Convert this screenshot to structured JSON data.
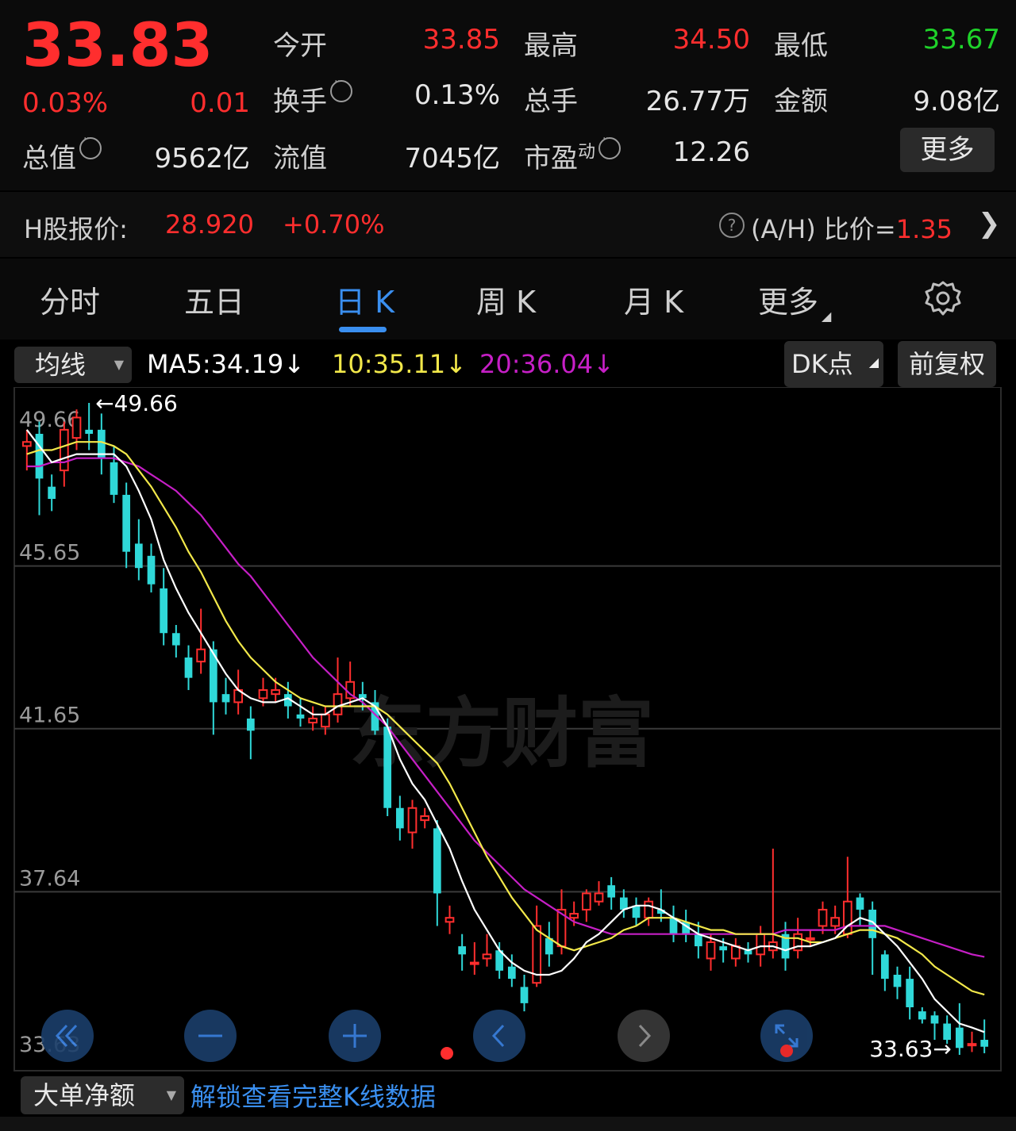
{
  "quote": {
    "price": "33.83",
    "change_pct": "0.03%",
    "change": "0.01",
    "open_label": "今开",
    "open": "33.85",
    "high_label": "最高",
    "high": "34.50",
    "low_label": "最低",
    "low": "33.67",
    "turnover_label": "换手",
    "turnover": "0.13%",
    "volume_label": "总手",
    "volume": "26.77万",
    "amount_label": "金额",
    "amount": "9.08亿",
    "mktcap_label": "总值",
    "mktcap": "9562亿",
    "float_label": "流值",
    "float": "7045亿",
    "pe_label": "市盈",
    "pe_sup": "动",
    "pe": "12.26",
    "more_label": "更多"
  },
  "hshare": {
    "label": "H股报价:",
    "price": "28.920",
    "change": "+0.70%",
    "ratio_label": "(A/H) 比价=",
    "ratio": "1.35"
  },
  "tabs": [
    {
      "label": "分时"
    },
    {
      "label": "五日"
    },
    {
      "label": "日 K"
    },
    {
      "label": "周 K"
    },
    {
      "label": "月 K"
    },
    {
      "label": "更多"
    }
  ],
  "chart_controls": {
    "indicator": "均线",
    "ma5": "MA5:34.19↓",
    "ma10": "10:35.11↓",
    "ma20": "20:36.04↓",
    "dk_label": "DK点",
    "adjust_label": "前复权"
  },
  "bottom": {
    "indicator": "大单净额",
    "unlock": "解锁查看完整K线数据"
  },
  "watermark": "东方财富",
  "colors": {
    "up": "#ff2e2e",
    "down": "#2fd8d8",
    "ma5": "#ffffff",
    "ma10": "#f2e84a",
    "ma20": "#c61fc6",
    "accent": "#3a8ff0"
  },
  "chart_data": {
    "type": "candlestick",
    "ylim": [
      33.63,
      49.66
    ],
    "y_ticks": [
      "49.66",
      "45.65",
      "41.65",
      "37.64",
      "33.63"
    ],
    "max_label": "←49.66",
    "min_label": "33.63→",
    "candles": [
      [
        48.6,
        48.7,
        49.0,
        48.0
      ],
      [
        48.9,
        47.8,
        49.2,
        46.9
      ],
      [
        47.6,
        47.3,
        47.9,
        47.0
      ],
      [
        48.0,
        49.0,
        49.2,
        47.6
      ],
      [
        48.8,
        49.3,
        49.5,
        48.5
      ],
      [
        49.0,
        48.9,
        49.66,
        48.5
      ],
      [
        49.0,
        48.3,
        49.4,
        47.9
      ],
      [
        48.2,
        47.4,
        48.6,
        47.2
      ],
      [
        47.4,
        46.0,
        47.7,
        45.6
      ],
      [
        46.2,
        45.6,
        46.8,
        45.3
      ],
      [
        45.9,
        45.2,
        46.2,
        45.0
      ],
      [
        45.1,
        44.0,
        45.6,
        43.7
      ],
      [
        44.0,
        43.7,
        44.2,
        43.4
      ],
      [
        43.4,
        42.9,
        43.7,
        42.6
      ],
      [
        43.3,
        43.6,
        44.6,
        43.0
      ],
      [
        43.6,
        42.3,
        43.8,
        41.5
      ],
      [
        42.5,
        42.3,
        42.9,
        42.0
      ],
      [
        42.3,
        42.6,
        43.1,
        42.0
      ],
      [
        41.9,
        41.6,
        42.2,
        40.9
      ],
      [
        42.4,
        42.6,
        42.9,
        42.2
      ],
      [
        42.5,
        42.6,
        42.9,
        42.3
      ],
      [
        42.5,
        42.2,
        42.8,
        41.9
      ],
      [
        42.0,
        41.9,
        42.4,
        41.7
      ],
      [
        41.8,
        41.9,
        42.2,
        41.6
      ],
      [
        41.7,
        42.0,
        42.2,
        41.5
      ],
      [
        42.0,
        42.5,
        43.4,
        41.8
      ],
      [
        42.4,
        42.8,
        43.3,
        42.2
      ],
      [
        42.5,
        42.4,
        42.8,
        42.1
      ],
      [
        42.3,
        41.6,
        42.6,
        41.5
      ],
      [
        41.7,
        39.7,
        41.9,
        39.5
      ],
      [
        39.7,
        39.2,
        40.0,
        38.9
      ],
      [
        39.1,
        39.7,
        39.9,
        38.7
      ],
      [
        39.4,
        39.5,
        39.7,
        39.2
      ],
      [
        39.2,
        37.6,
        39.4,
        36.8
      ],
      [
        36.9,
        37.0,
        37.3,
        36.6
      ],
      [
        36.3,
        36.1,
        36.6,
        35.7
      ],
      [
        35.9,
        35.9,
        36.4,
        35.6
      ],
      [
        36.0,
        36.1,
        36.6,
        35.8
      ],
      [
        36.2,
        35.7,
        36.4,
        35.5
      ],
      [
        35.8,
        35.5,
        36.1,
        35.3
      ],
      [
        35.3,
        34.9,
        35.6,
        34.7
      ],
      [
        35.4,
        36.8,
        37.3,
        35.3
      ],
      [
        36.5,
        36.1,
        36.9,
        35.8
      ],
      [
        36.3,
        37.2,
        37.7,
        36.1
      ],
      [
        37.0,
        37.1,
        37.4,
        36.8
      ],
      [
        37.2,
        37.6,
        37.7,
        36.9
      ],
      [
        37.4,
        37.6,
        37.9,
        37.3
      ],
      [
        37.8,
        37.5,
        38.0,
        37.2
      ],
      [
        37.5,
        37.2,
        37.7,
        37.0
      ],
      [
        37.3,
        37.0,
        37.5,
        36.8
      ],
      [
        37.0,
        37.4,
        37.5,
        36.8
      ],
      [
        37.2,
        37.1,
        37.7,
        36.9
      ],
      [
        37.0,
        36.6,
        37.3,
        36.4
      ],
      [
        36.9,
        36.6,
        37.2,
        36.4
      ],
      [
        36.6,
        36.3,
        36.9,
        36.0
      ],
      [
        36.0,
        36.4,
        36.6,
        35.7
      ],
      [
        36.3,
        36.2,
        36.5,
        35.9
      ],
      [
        36.0,
        36.3,
        36.5,
        35.8
      ],
      [
        36.2,
        36.1,
        36.4,
        35.9
      ],
      [
        36.1,
        36.6,
        36.8,
        35.8
      ],
      [
        36.2,
        36.4,
        38.7,
        36.0
      ],
      [
        36.6,
        36.0,
        36.9,
        35.7
      ],
      [
        36.2,
        36.6,
        37.0,
        36.0
      ],
      [
        36.5,
        36.5,
        36.7,
        36.3
      ],
      [
        36.8,
        37.2,
        37.4,
        36.6
      ],
      [
        36.8,
        37.0,
        37.3,
        36.6
      ],
      [
        36.6,
        37.4,
        38.5,
        36.5
      ],
      [
        37.5,
        37.2,
        37.6,
        36.8
      ],
      [
        37.2,
        36.5,
        37.4,
        35.6
      ],
      [
        36.1,
        35.5,
        36.2,
        35.2
      ],
      [
        35.6,
        35.3,
        35.8,
        35.0
      ],
      [
        35.5,
        34.8,
        35.8,
        34.5
      ],
      [
        34.7,
        34.5,
        34.8,
        34.4
      ],
      [
        34.6,
        34.4,
        34.7,
        34.0
      ],
      [
        34.4,
        34.0,
        34.6,
        33.9
      ],
      [
        34.3,
        33.8,
        34.9,
        33.63
      ],
      [
        33.9,
        33.9,
        34.2,
        33.7
      ],
      [
        34.0,
        33.83,
        34.5,
        33.67
      ]
    ],
    "ma5": [
      49.0,
      48.6,
      48.2,
      48.3,
      48.4,
      48.4,
      48.4,
      48.4,
      48.1,
      47.5,
      46.8,
      45.8,
      45.1,
      44.5,
      44.0,
      43.5,
      43.0,
      42.6,
      42.4,
      42.3,
      42.3,
      42.4,
      42.2,
      42.0,
      42.0,
      42.2,
      42.3,
      42.4,
      42.2,
      41.7,
      40.9,
      40.3,
      39.9,
      39.3,
      38.7,
      37.9,
      37.2,
      36.7,
      36.2,
      35.9,
      35.7,
      35.6,
      35.6,
      35.7,
      36.0,
      36.4,
      36.6,
      36.9,
      37.2,
      37.3,
      37.3,
      37.2,
      37.0,
      36.8,
      36.6,
      36.5,
      36.4,
      36.3,
      36.2,
      36.3,
      36.3,
      36.2,
      36.3,
      36.3,
      36.4,
      36.5,
      36.8,
      37.0,
      36.9,
      36.6,
      36.3,
      35.9,
      35.5,
      35.0,
      34.7,
      34.4,
      34.3,
      34.19
    ],
    "ma10": [
      48.4,
      48.5,
      48.5,
      48.6,
      48.7,
      48.7,
      48.7,
      48.6,
      48.4,
      48.0,
      47.6,
      47.1,
      46.6,
      46.0,
      45.5,
      44.9,
      44.3,
      43.8,
      43.4,
      43.1,
      42.8,
      42.6,
      42.4,
      42.3,
      42.2,
      42.2,
      42.2,
      42.2,
      42.2,
      42.0,
      41.7,
      41.4,
      41.1,
      40.8,
      40.3,
      39.7,
      39.1,
      38.5,
      38.0,
      37.5,
      37.1,
      36.7,
      36.5,
      36.3,
      36.2,
      36.3,
      36.4,
      36.5,
      36.7,
      36.8,
      37.0,
      37.0,
      37.0,
      36.9,
      36.8,
      36.7,
      36.7,
      36.6,
      36.6,
      36.6,
      36.6,
      36.5,
      36.5,
      36.4,
      36.4,
      36.5,
      36.6,
      36.7,
      36.7,
      36.6,
      36.5,
      36.3,
      36.1,
      35.8,
      35.6,
      35.4,
      35.2,
      35.11
    ],
    "ma20": [
      48.1,
      48.1,
      48.2,
      48.2,
      48.3,
      48.3,
      48.3,
      48.3,
      48.2,
      48.1,
      47.9,
      47.7,
      47.5,
      47.2,
      46.9,
      46.5,
      46.1,
      45.7,
      45.4,
      45.0,
      44.6,
      44.2,
      43.8,
      43.4,
      43.1,
      42.8,
      42.5,
      42.3,
      42.0,
      41.7,
      41.3,
      40.9,
      40.5,
      40.1,
      39.7,
      39.3,
      38.9,
      38.6,
      38.3,
      38.0,
      37.7,
      37.5,
      37.3,
      37.1,
      36.9,
      36.8,
      36.7,
      36.6,
      36.6,
      36.6,
      36.6,
      36.6,
      36.6,
      36.6,
      36.6,
      36.6,
      36.6,
      36.6,
      36.6,
      36.6,
      36.6,
      36.7,
      36.7,
      36.7,
      36.7,
      36.7,
      36.8,
      36.8,
      36.8,
      36.8,
      36.7,
      36.6,
      36.5,
      36.4,
      36.3,
      36.2,
      36.1,
      36.04
    ]
  }
}
